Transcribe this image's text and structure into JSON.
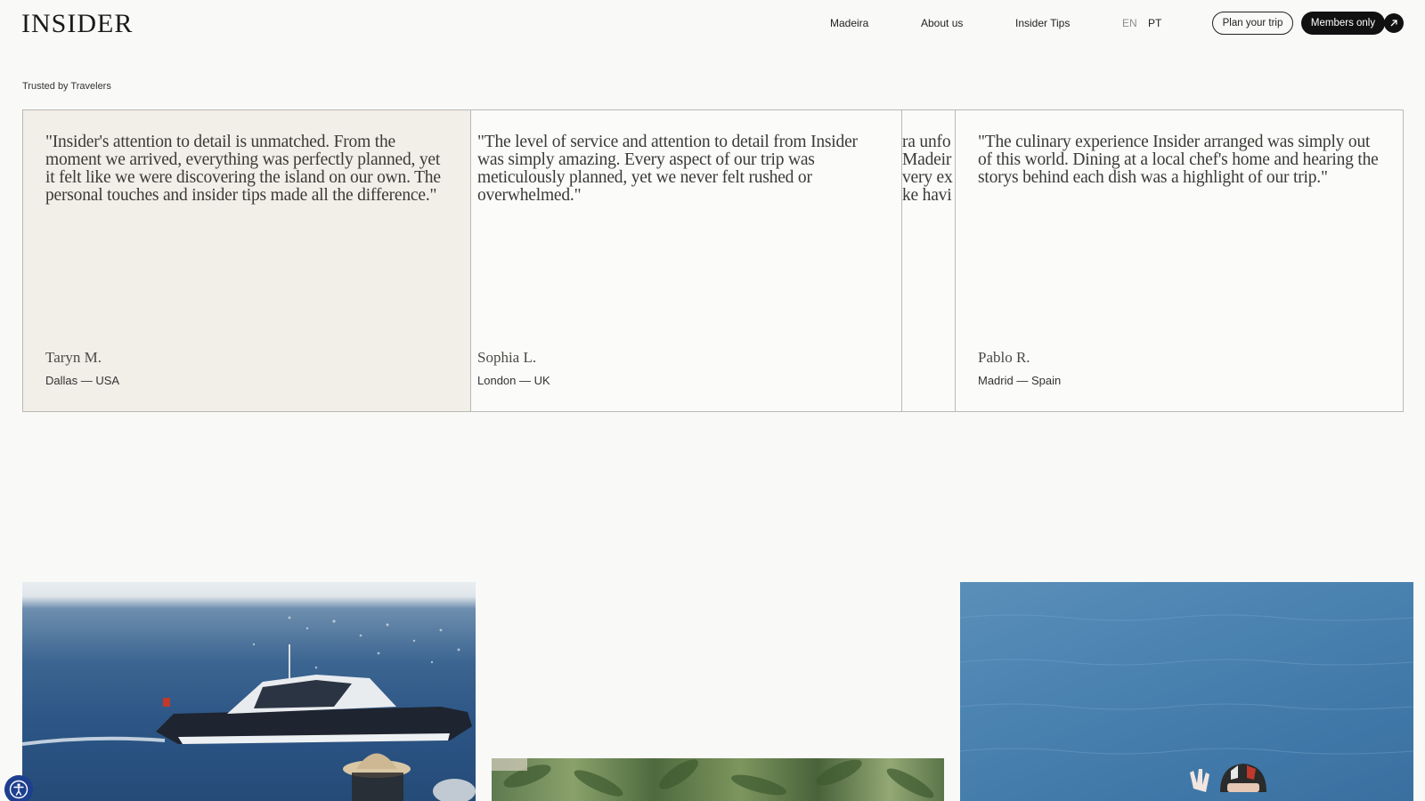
{
  "header": {
    "logo": "INSIDER",
    "nav": [
      "Madeira",
      "About us",
      "Insider Tips"
    ],
    "lang": {
      "en": "EN",
      "pt": "PT"
    },
    "plan_label": "Plan your trip",
    "members_label": "Members only"
  },
  "section": {
    "label": "Trusted by Travelers"
  },
  "testimonials": [
    {
      "quote": "\"Insider's attention to detail is unmatched. From the moment we arrived, everything was perfectly planned, yet it felt like we were discovering the island on our own. The personal touches and insider tips made all the difference.\"",
      "name": "Taryn M.",
      "place": "Dallas — USA"
    },
    {
      "quote": "\"The level of service and attention to detail from Insider was simply amazing. Every aspect of our trip was meticulously planned, yet we never felt rushed or overwhelmed.\"",
      "name": "Sophia L.",
      "place": "London — UK"
    },
    {
      "quote": "ra unfo\nMadeir\nvery ex\nke havi"
    },
    {
      "quote": "\"The culinary experience Insider arranged was simply out of this world. Dining at a local chef's home and hearing the storys behind each dish was a highlight of our trip.\"",
      "name": "Pablo R.",
      "place": "Madrid — Spain"
    }
  ],
  "colors": {
    "background": "#f9f9f8",
    "active_card": "#f2eee8",
    "button_dark": "#111111",
    "accessibility": "#1d3f8f"
  },
  "icons": {
    "arrow": "arrow-up-right-icon",
    "accessibility": "accessibility-icon"
  }
}
